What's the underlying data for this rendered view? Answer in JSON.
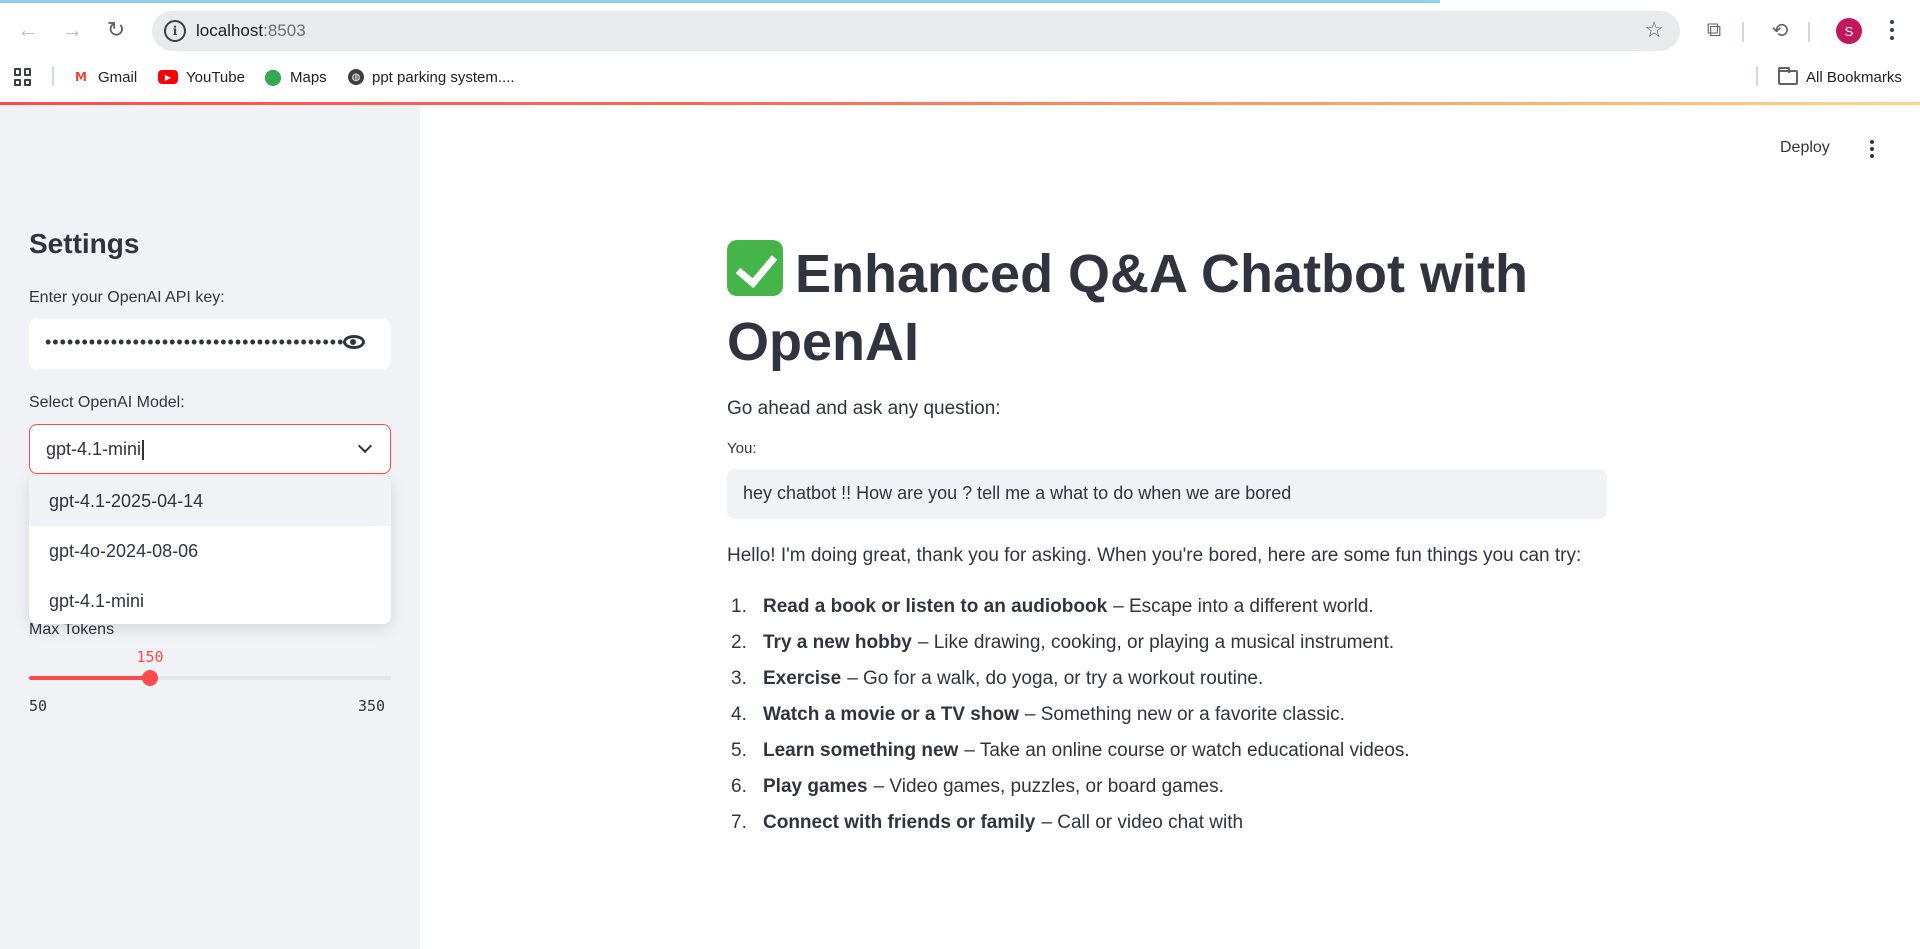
{
  "browser": {
    "url_host": "localhost",
    "url_port": ":8503",
    "avatar_letter": "S",
    "bookmarks": [
      {
        "label": "Gmail",
        "icon": "gmail-icon"
      },
      {
        "label": "YouTube",
        "icon": "youtube-icon"
      },
      {
        "label": "Maps",
        "icon": "maps-icon"
      },
      {
        "label": "ppt parking system....",
        "icon": "globe-icon"
      }
    ],
    "all_bookmarks": "All Bookmarks"
  },
  "sidebar": {
    "title": "Settings",
    "api_key_label": "Enter your OpenAI API key:",
    "api_key_masked": "••••••••••••••••••••••••••••••••••••••••••••••••••",
    "model_label": "Select OpenAI Model:",
    "model_value": "gpt-4.1-mini",
    "model_options": [
      "gpt-4.1-2025-04-14",
      "gpt-4o-2024-08-06",
      "gpt-4.1-mini"
    ],
    "max_tokens": {
      "label": "Max Tokens",
      "value": 150,
      "min": 50,
      "max": 350,
      "value_text": "150",
      "min_text": "50",
      "max_text": "350"
    }
  },
  "header": {
    "deploy_label": "Deploy"
  },
  "main": {
    "title": "Enhanced Q&A Chatbot with OpenAI",
    "subtitle": "Go ahead and ask any question:",
    "you_label": "You:",
    "user_input": "hey chatbot !! How are you ? tell me a what to do when we are bored",
    "answer_intro": "Hello! I'm doing great, thank you for asking. When you're bored, here are some fun things you can try:",
    "items": [
      {
        "num": "1.",
        "bold": "Read a book or listen to an audiobook",
        "text": "– Escape into a different world."
      },
      {
        "num": "2.",
        "bold": "Try a new hobby",
        "text": "– Like drawing, cooking, or playing a musical instrument."
      },
      {
        "num": "3.",
        "bold": "Exercise",
        "text": "– Go for a walk, do yoga, or try a workout routine."
      },
      {
        "num": "4.",
        "bold": "Watch a movie or a TV show",
        "text": "– Something new or a favorite classic."
      },
      {
        "num": "5.",
        "bold": "Learn something new",
        "text": "– Take an online course or watch educational videos."
      },
      {
        "num": "6.",
        "bold": "Play games",
        "text": "– Video games, puzzles, or board games."
      },
      {
        "num": "7.",
        "bold": "Connect with friends or family",
        "text": "– Call or video chat with"
      }
    ]
  },
  "colors": {
    "accent": "#ff4b4b",
    "sidebar_bg": "#f0f2f6",
    "text": "#31333f",
    "check_green": "#45b549"
  }
}
